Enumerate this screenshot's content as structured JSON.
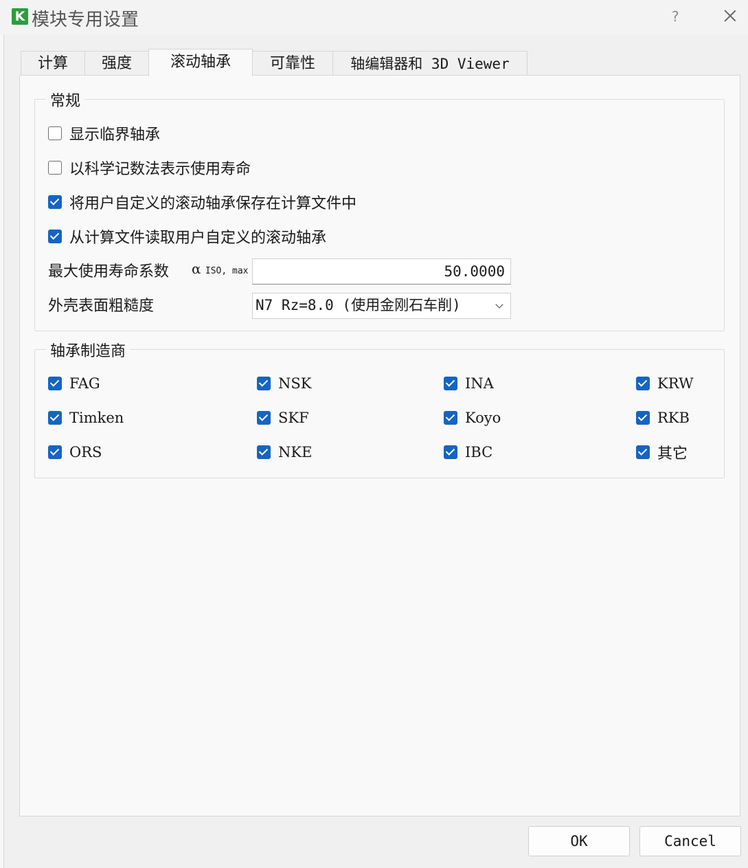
{
  "window": {
    "logo_letter": "K",
    "title": "模块专用设置",
    "help_label": "?"
  },
  "tabs": [
    {
      "label": "计算"
    },
    {
      "label": "强度"
    },
    {
      "label": "滚动轴承"
    },
    {
      "label": "可靠性"
    },
    {
      "label": "轴编辑器和 3D Viewer"
    }
  ],
  "general": {
    "title": "常规",
    "options": [
      {
        "label": "显示临界轴承",
        "checked": false
      },
      {
        "label": "以科学记数法表示使用寿命",
        "checked": false
      },
      {
        "label": "将用户自定义的滚动轴承保存在计算文件中",
        "checked": true
      },
      {
        "label": "从计算文件读取用户自定义的滚动轴承",
        "checked": true
      }
    ],
    "max_life_label": "最大使用寿命系数",
    "alpha_symbol": "α",
    "alpha_subscript": "ISO, max",
    "max_life_value": "50.0000",
    "roughness_label": "外壳表面粗糙度",
    "roughness_value": "N7   Rz=8.0 (使用金刚石车削)"
  },
  "manufacturers": {
    "title": "轴承制造商",
    "items": [
      {
        "label": "FAG",
        "checked": true
      },
      {
        "label": "NSK",
        "checked": true
      },
      {
        "label": "INA",
        "checked": true
      },
      {
        "label": "KRW",
        "checked": true
      },
      {
        "label": "Timken",
        "checked": true
      },
      {
        "label": "SKF",
        "checked": true
      },
      {
        "label": "Koyo",
        "checked": true
      },
      {
        "label": "RKB",
        "checked": true
      },
      {
        "label": "ORS",
        "checked": true
      },
      {
        "label": "NKE",
        "checked": true
      },
      {
        "label": "IBC",
        "checked": true
      },
      {
        "label": "其它",
        "checked": true
      }
    ]
  },
  "buttons": {
    "ok": "OK",
    "cancel": "Cancel"
  },
  "colors": {
    "accent": "#1565c0",
    "logo": "#2e9d3f"
  }
}
